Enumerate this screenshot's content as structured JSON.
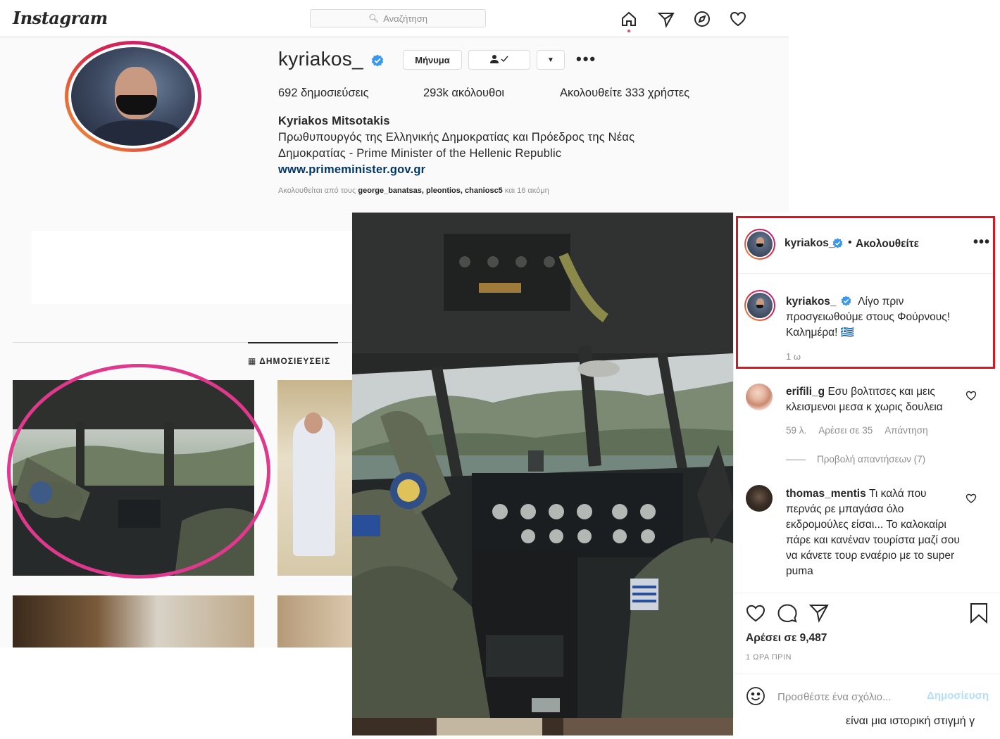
{
  "colors": {
    "accent_red": "#e0141e",
    "annotation_pink": "#e0388c",
    "verified_blue": "#3897f0",
    "link_blue": "#00376b",
    "muted": "#8e8e8e",
    "publish_disabled": "#b2dffc"
  },
  "topnav": {
    "logo": "Instagram",
    "search_placeholder": "Αναζήτηση",
    "icons": [
      "home-icon",
      "direct-icon",
      "explore-icon",
      "activity-heart-icon"
    ]
  },
  "profile": {
    "username": "kyriakos_",
    "message_button": "Μήνυμα",
    "following_button_icon": "person-check-icon",
    "stats": {
      "posts": "692 δημοσιεύσεις",
      "followers": "293k ακόλουθοι",
      "following": "Ακολουθείτε 333 χρήστες"
    },
    "full_name": "Kyriakos Mitsotakis",
    "bio_line1": "Πρωθυπουργός της Ελληνικής Δημοκρατίας και Πρόεδρος της Νέας",
    "bio_line2": "Δημοκρατίας - Prime Minister of the Hellenic Republic",
    "website": "www.primeminister.gov.gr",
    "followed_by_prefix": "Ακολουθείται από τους",
    "followed_by_users": "george_banatsas, pleontios, chaniosc5",
    "followed_by_suffix": "και 16 ακόμη",
    "tab_posts": "ΔΗΜΟΣΙΕΥΣΕΙΣ"
  },
  "post": {
    "header": {
      "username": "kyriakos_",
      "dot": "•",
      "follow_status": "Ακολουθείτε"
    },
    "caption": {
      "username": "kyriakos_",
      "text": "Λίγο πριν προσγειωθούμε στους Φούρνους! Καλημέρα! 🇬🇷",
      "time": "1 ω"
    },
    "comments": [
      {
        "username": "erifili_g",
        "text": "Εσυ βολτιτσες και μεις κλεισμενοι μεσα κ χωρις δουλεια",
        "age": "59 λ.",
        "likes": "Αρέσει σε 35",
        "reply": "Απάντηση",
        "view_replies": "Προβολή απαντήσεων (7)"
      },
      {
        "username": "thomas_mentis",
        "text": "Τι καλά που περνάς ρε μπαγάσα όλο εκδρομούλες είσαι... Το καλοκαίρι πάρε και κανέναν τουρίστα μαζί σου να κάνετε τουρ εναέριο με το super puma"
      }
    ],
    "likes": "Αρέσει σε 9,487",
    "timestamp": "1 ΩΡΑ ΠΡΙΝ",
    "comment_placeholder": "Προσθέστε ένα σχόλιο...",
    "publish": "Δημοσίευση",
    "trailing_text": "είναι μια ιστορική στιγμή γ"
  }
}
